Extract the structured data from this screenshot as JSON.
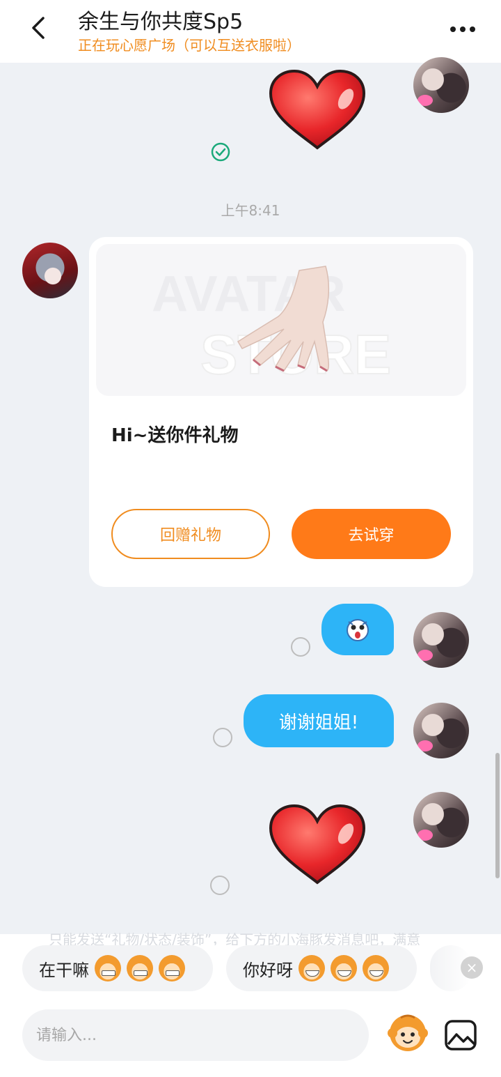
{
  "header": {
    "title": "余生与你共度Sp5",
    "subtitle": "正在玩心愿广场（可以互送衣服啦）"
  },
  "chat": {
    "timestamp": "上午8:41",
    "gift_card": {
      "title": "Hi~送你件礼物",
      "image_watermark_1": "AVATAR",
      "image_watermark_2": "STORE",
      "return_gift_label": "回赠礼物",
      "try_on_label": "去试穿"
    },
    "messages": [
      {
        "text": "谢谢姐姐!"
      }
    ]
  },
  "bottom": {
    "faded_hint": "只能发送“礼物/状态/装饰”，给下方的小海豚发消息吧，满意",
    "quick_replies": [
      {
        "label": "在干嘛"
      },
      {
        "label": "你好呀"
      }
    ],
    "close_glyph": "×",
    "input_placeholder": "请输入..."
  },
  "colors": {
    "accent": "#ff7a18",
    "subtitle": "#f08c1f",
    "bubble": "#2db4f7"
  }
}
